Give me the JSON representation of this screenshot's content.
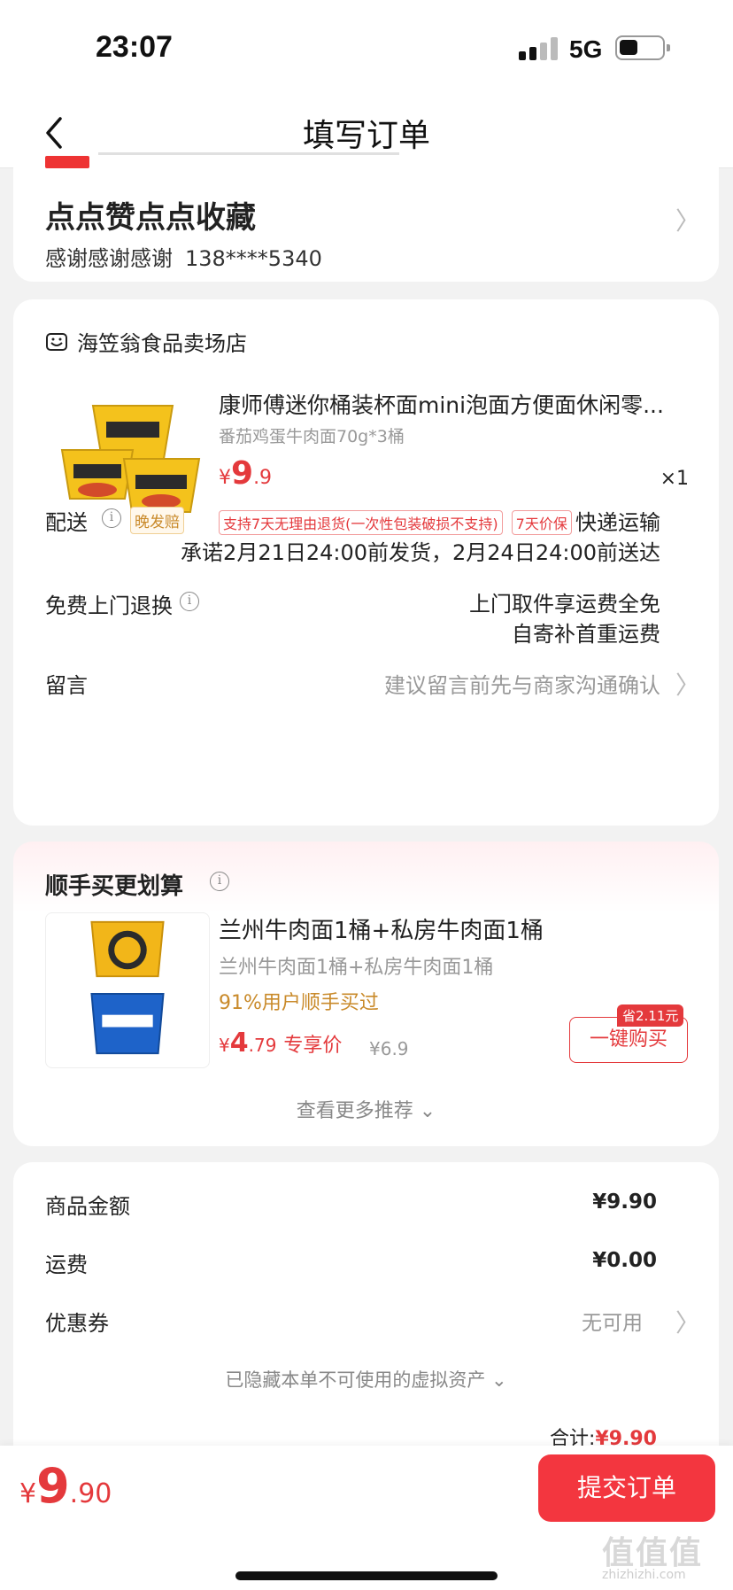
{
  "status_bar": {
    "time": "23:07",
    "network": "5G"
  },
  "nav": {
    "title": "填写订单"
  },
  "address": {
    "name": "点点赞点点收藏",
    "contact_name": "感谢感谢感谢",
    "phone": "138****5340"
  },
  "shop": {
    "name": "海笠翁食品卖场店"
  },
  "product": {
    "title": "康师傅迷你桶装杯面mini泡面方便面休闲零...",
    "spec": "番茄鸡蛋牛肉面70g*3桶",
    "price_symbol": "¥",
    "price_int": "9",
    "price_dec": ".9",
    "qty": "×1",
    "tags": [
      "支持7天无理由退货(一次性包装破损不支持)",
      "7天价保"
    ]
  },
  "delivery": {
    "label": "配送",
    "badge": "晚发赔",
    "method": "快递运输",
    "promise": "承诺2月21日24:00前发货，2月24日24:00前送达"
  },
  "return_service": {
    "label": "免费上门退换",
    "line1": "上门取件享运费全免",
    "line2": "自寄补首重运费"
  },
  "message": {
    "label": "留言",
    "placeholder": "建议留言前先与商家沟通确认"
  },
  "recommend": {
    "title": "顺手买更划算",
    "name": "兰州牛肉面1桶+私房牛肉面1桶",
    "sub": "兰州牛肉面1桶+私房牛肉面1桶",
    "percent": "91%用户顺手买过",
    "price_symbol": "¥",
    "price_int": "4",
    "price_dec": ".79",
    "price_label": "专享价",
    "original_price": "¥6.9",
    "save_badge": "省2.11元",
    "buy_label": "一键购买",
    "more_label": "查看更多推荐"
  },
  "summary": {
    "goods_label": "商品金额",
    "goods_value": "¥9.90",
    "shipping_label": "运费",
    "shipping_value": "¥0.00",
    "coupon_label": "优惠券",
    "coupon_value": "无可用",
    "hidden_note": "已隐藏本单不可使用的虚拟资产",
    "total_label": "合计:",
    "total_value": "¥9.90"
  },
  "bottom": {
    "price_symbol": "¥",
    "price_int": "9",
    "price_dec": ".90",
    "submit_label": "提交订单"
  },
  "watermark": {
    "text": "值值值",
    "sub": "zhizhizhi.com"
  },
  "colors": {
    "accent": "#e4393c",
    "submit": "#f3363f",
    "badge": "#c98a2a"
  }
}
